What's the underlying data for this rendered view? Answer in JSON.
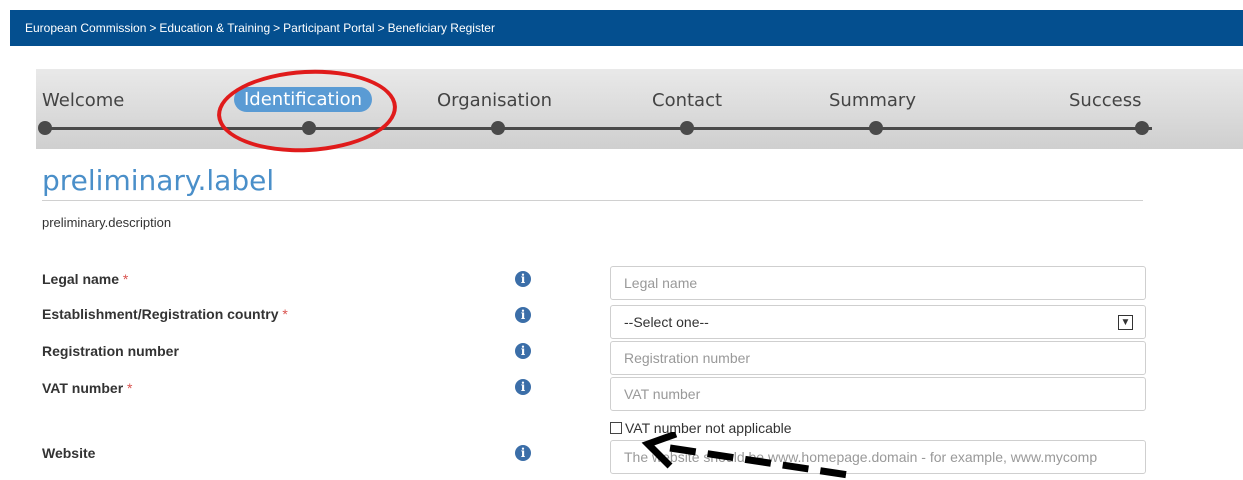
{
  "breadcrumb": {
    "items": [
      "European Commission",
      "Education & Training",
      "Participant Portal",
      "Beneficiary Register"
    ],
    "separator": ">"
  },
  "stepper": {
    "steps": [
      "Welcome",
      "Identification",
      "Organisation",
      "Contact",
      "Summary",
      "Success"
    ],
    "active_index": 1
  },
  "page": {
    "title": "preliminary.label",
    "description": "preliminary.description"
  },
  "form": {
    "legal_name": {
      "label": "Legal name",
      "required": "*",
      "placeholder": "Legal name"
    },
    "country": {
      "label": "Establishment/Registration country",
      "required": "*",
      "value": "--Select one--"
    },
    "registration_number": {
      "label": "Registration number",
      "placeholder": "Registration number"
    },
    "vat_number": {
      "label": "VAT number",
      "required": "*",
      "placeholder": "VAT number"
    },
    "vat_not_applicable": {
      "label": "VAT number not applicable",
      "checked": false
    },
    "website": {
      "label": "Website",
      "placeholder": "The website should be www.homepage.domain - for example, www.mycomp"
    }
  },
  "icons": {
    "info": "info-icon",
    "dropdown": "chevron-down-icon"
  },
  "colors": {
    "header_bg": "#044f8f",
    "accent": "#4a8fc9",
    "active_step": "#5a9bd4",
    "required": "#d9534f",
    "annotation": "#e01b1b"
  }
}
